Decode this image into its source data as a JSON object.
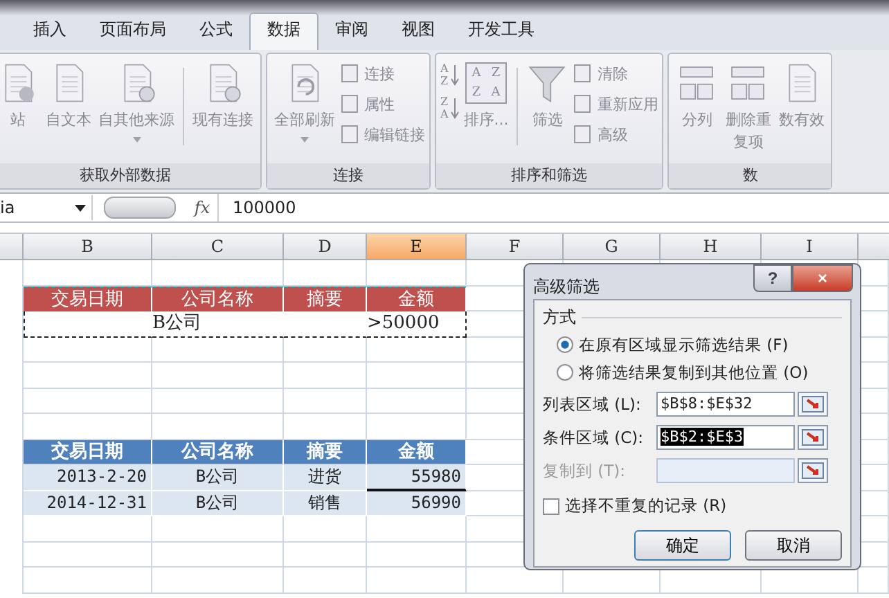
{
  "tabs": [
    {
      "label": "插入",
      "selected": false
    },
    {
      "label": "页面布局",
      "selected": false
    },
    {
      "label": "公式",
      "selected": false
    },
    {
      "label": "数据",
      "selected": true
    },
    {
      "label": "审阅",
      "selected": false
    },
    {
      "label": "视图",
      "selected": false
    },
    {
      "label": "开发工具",
      "selected": false
    }
  ],
  "ribbon_groups": [
    {
      "label": "获取外部数据",
      "items": [
        {
          "kind": "large",
          "label": "站"
        },
        {
          "kind": "large",
          "label": "自文本"
        },
        {
          "kind": "large",
          "label": "自其他来源",
          "dropdown": true
        },
        {
          "kind": "sep"
        },
        {
          "kind": "large",
          "label": "现有连接"
        }
      ]
    },
    {
      "label": "连接",
      "items": [
        {
          "kind": "large",
          "label": "全部刷新",
          "dropdown": true
        },
        {
          "kind": "stack",
          "entries": [
            "连接",
            "属性",
            "编辑链接"
          ]
        }
      ]
    },
    {
      "label": "排序和筛选",
      "items": [
        {
          "kind": "sorticons",
          "ascending": [
            "A",
            "Z"
          ],
          "descending": [
            "Z",
            "A"
          ]
        },
        {
          "kind": "sortgrid",
          "letters": [
            "A",
            "Z",
            "Z",
            "A"
          ],
          "label": "排序..."
        },
        {
          "kind": "sep"
        },
        {
          "kind": "large",
          "label": "筛选"
        },
        {
          "kind": "stack",
          "entries": [
            "清除",
            "重新应用",
            "高级"
          ]
        }
      ]
    },
    {
      "label": "数",
      "items": [
        {
          "kind": "large",
          "label": "分列"
        },
        {
          "kind": "large",
          "label": "删除重复项"
        },
        {
          "kind": "large",
          "label": "数有效"
        }
      ]
    }
  ],
  "formula_bar": {
    "name_box": "ia",
    "fx": "fx",
    "value": "100000"
  },
  "columns": [
    {
      "label": "B",
      "selected": false
    },
    {
      "label": "C",
      "selected": false
    },
    {
      "label": "D",
      "selected": false
    },
    {
      "label": "E",
      "selected": true
    },
    {
      "label": "F",
      "selected": false
    },
    {
      "label": "G",
      "selected": false
    },
    {
      "label": "H",
      "selected": false
    },
    {
      "label": "I",
      "selected": false
    }
  ],
  "criteria_table": {
    "header": [
      "交易日期",
      "公司名称",
      "摘要",
      "金额"
    ],
    "values": {
      "company_name": "B公司",
      "amount": ">50000"
    }
  },
  "result_table": {
    "header": [
      "交易日期",
      "公司名称",
      "摘要",
      "金额"
    ],
    "rows": [
      [
        "2013-2-20",
        "B公司",
        "进货",
        "55980"
      ],
      [
        "2014-12-31",
        "B公司",
        "销售",
        "56990"
      ]
    ]
  },
  "dialog": {
    "title": "高级筛选",
    "help": "?",
    "close": "×",
    "section": "方式",
    "radios": [
      {
        "label": "在原有区域显示筛选结果 (F)",
        "selected": true
      },
      {
        "label": "将筛选结果复制到其他位置 (O)",
        "selected": false
      }
    ],
    "fields": [
      {
        "label": "列表区域 (L):",
        "value": "$B$8:$E$32",
        "disabled": false
      },
      {
        "label": "条件区域 (C):",
        "value": "$B$2:$E$3",
        "disabled": false,
        "highlighted": true
      },
      {
        "label": "复制到 (T):",
        "disabled": true
      }
    ],
    "checkbox": {
      "label": "选择不重复的记录 (R)",
      "checked": false
    },
    "buttons": [
      "确定",
      "取消"
    ]
  }
}
